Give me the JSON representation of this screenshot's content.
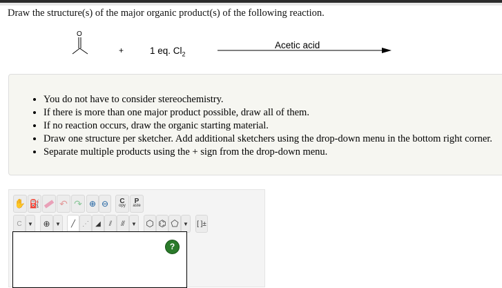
{
  "question": "Draw the structure(s) of the major organic product(s) of the following reaction.",
  "reaction": {
    "reactant": "acetone",
    "plus": "+",
    "reagent": "1 eq. Cl",
    "reagent_sub": "2",
    "conditions": "Acetic acid"
  },
  "instructions": [
    "You do not have to consider stereochemistry.",
    "If there is more than one major product possible, draw all of them.",
    "If no reaction occurs, draw the organic starting material.",
    "Draw one structure per sketcher. Add additional sketchers using the drop-down menu in the bottom right corner.",
    "Separate multiple products using the + sign from the drop-down menu."
  ],
  "sketcher": {
    "copy_top": "C",
    "copy_bottom": "opy",
    "paste_top": "P",
    "paste_bottom": "aste",
    "atom": "C",
    "bracket": "[ ]±",
    "help": "?"
  }
}
